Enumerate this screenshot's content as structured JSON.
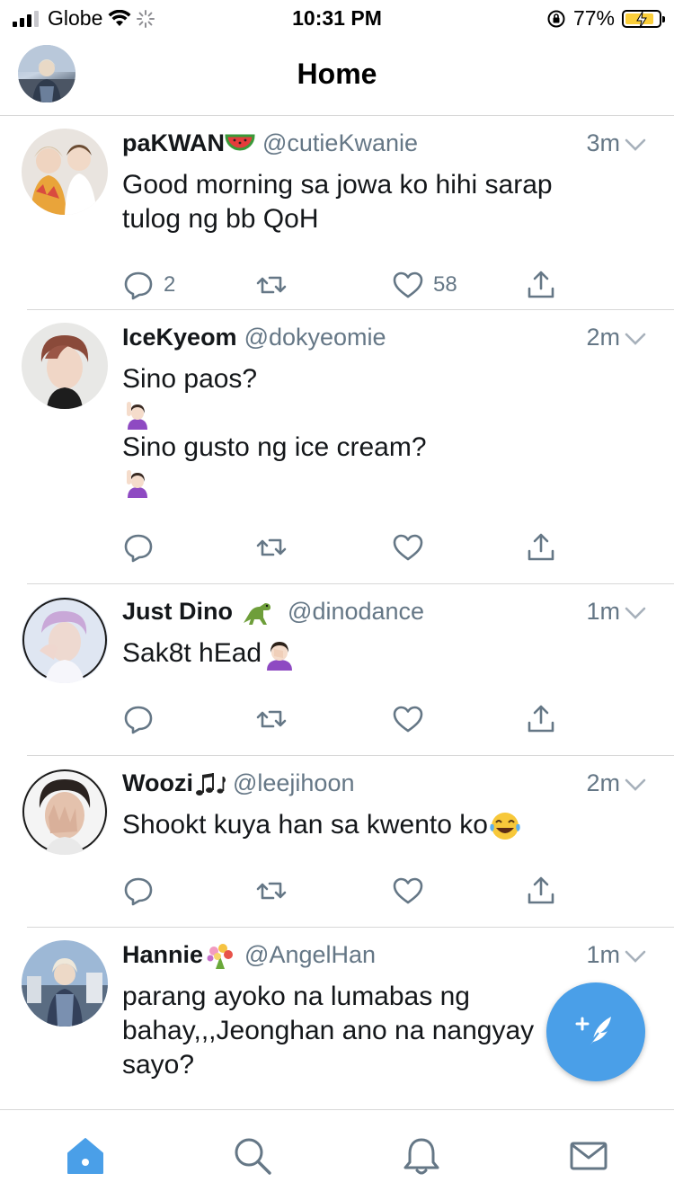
{
  "status_bar": {
    "carrier": "Globe",
    "time": "10:31 PM",
    "battery": "77%"
  },
  "header": {
    "title": "Home"
  },
  "tweets": [
    {
      "name": "paKWAN",
      "handle": "@cutieKwanie",
      "time": "3m",
      "lines": [
        "Good morning sa jowa ko hihi sarap",
        "tulog ng bb QoH"
      ],
      "replies": "2",
      "likes": "58"
    },
    {
      "name": "IceKyeom",
      "handle": "@dokyeomie",
      "time": "2m",
      "lines": [
        "Sino paos?",
        "Sino gusto ng ice cream?"
      ]
    },
    {
      "name": "Just Dino",
      "handle": "@dinodance",
      "time": "1m",
      "lines": [
        "Sak8t hEad"
      ]
    },
    {
      "name": "Woozi",
      "handle": "@leejihoon",
      "time": "2m",
      "lines": [
        "Shookt kuya han sa kwento ko"
      ]
    },
    {
      "name": "Hannie",
      "handle": "@AngelHan",
      "time": "1m",
      "lines": [
        "parang ayoko na lumabas ng",
        "bahay,,,Jeonghan ano na nangyay",
        "sayo?"
      ]
    }
  ],
  "tabs": [
    "home-icon",
    "search-icon",
    "bell-icon",
    "mail-icon"
  ],
  "colors": {
    "accent": "#4a9fe8",
    "secondary_text": "#657786",
    "divider": "#d8d8d8"
  }
}
